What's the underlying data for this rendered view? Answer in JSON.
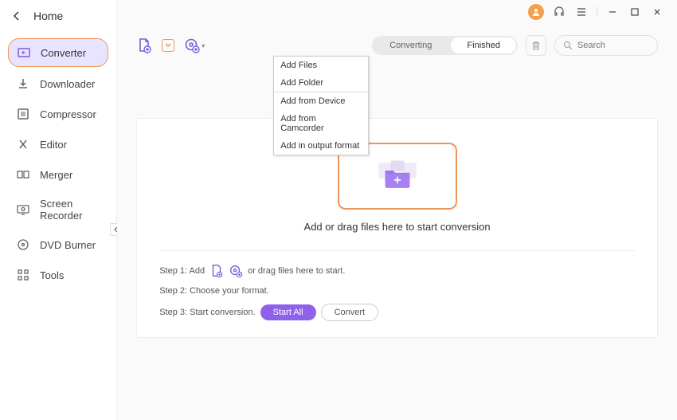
{
  "sidebar": {
    "home_label": "Home",
    "items": [
      {
        "label": "Converter",
        "icon": "converter-icon",
        "active": true
      },
      {
        "label": "Downloader",
        "icon": "downloader-icon",
        "active": false
      },
      {
        "label": "Compressor",
        "icon": "compressor-icon",
        "active": false
      },
      {
        "label": "Editor",
        "icon": "editor-icon",
        "active": false
      },
      {
        "label": "Merger",
        "icon": "merger-icon",
        "active": false
      },
      {
        "label": "Screen Recorder",
        "icon": "screen-recorder-icon",
        "active": false
      },
      {
        "label": "DVD Burner",
        "icon": "dvd-burner-icon",
        "active": false
      },
      {
        "label": "Tools",
        "icon": "tools-icon",
        "active": false
      }
    ]
  },
  "titlebar": {
    "minimize": "—",
    "maximize": "☐",
    "close": "✕"
  },
  "toolbar": {
    "dropdown_menu": {
      "items": [
        "Add Files",
        "Add Folder",
        "Add from Device",
        "Add from Camcorder",
        "Add in output format"
      ]
    },
    "tabs": {
      "converting": "Converting",
      "finished": "Finished"
    },
    "search_placeholder": "Search"
  },
  "content": {
    "drop_text": "Add or drag files here to start conversion",
    "step1_prefix": "Step 1: Add",
    "step1_suffix": "or drag files here to start.",
    "step2": "Step 2: Choose your format.",
    "step3": "Step 3: Start conversion.",
    "start_all": "Start All",
    "convert": "Convert"
  },
  "colors": {
    "accent_orange": "#f0955a",
    "accent_purple": "#8f61ea",
    "folder_purple": "#9d74f0"
  }
}
